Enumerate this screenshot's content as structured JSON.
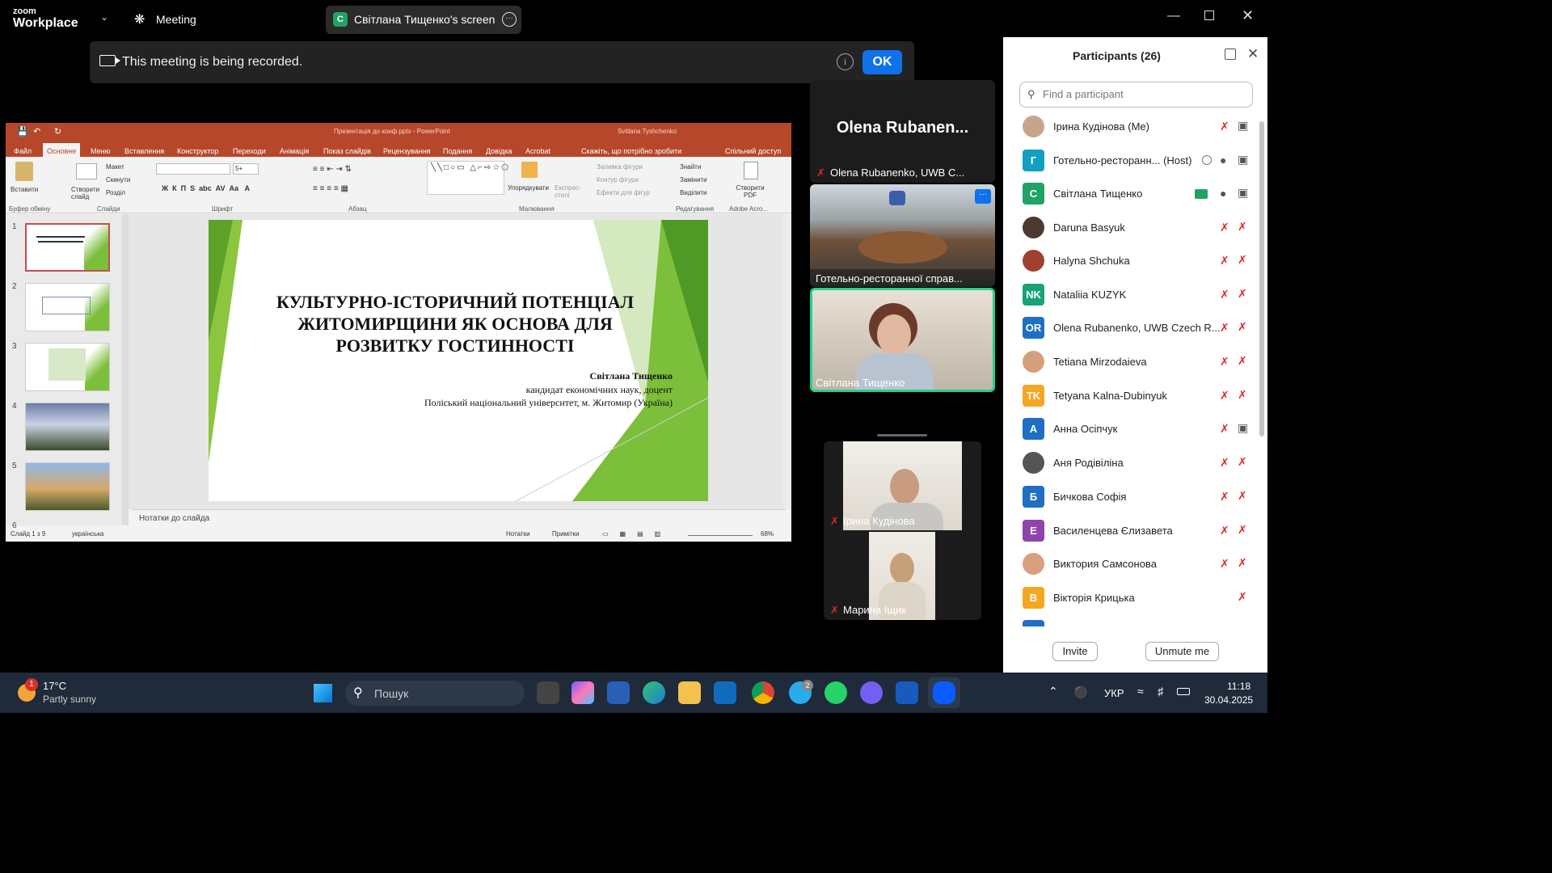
{
  "app": {
    "logo_top": "zoom",
    "logo_bottom": "Workplace",
    "meeting_label": "Meeting",
    "share_initial": "C",
    "share_label": "Світлана Тищенко's screen"
  },
  "recording": {
    "text": "This meeting is being recorded.",
    "ok_label": "OK"
  },
  "ppt": {
    "window_title": "Презентація до конф.pptx - PowerPoint",
    "user": "Svitlana Tyshchenko",
    "tabs": [
      "Файл",
      "Основне",
      "Меню",
      "Вставлення",
      "Конструктор",
      "Переходи",
      "Анімація",
      "Показ слайдів",
      "Рецензування",
      "Подання",
      "Довідка",
      "Acrobat"
    ],
    "tell_me": "Скажіть, що потрібно зробити",
    "share": "Спільний доступ",
    "groups": [
      "Буфер обміну",
      "Слайди",
      "Шрифт",
      "Абзац",
      "Малювання",
      "Редагування",
      "Adobe Acro..."
    ],
    "paste": "Вставити",
    "new_slide": "Створити слайд",
    "layout": "Макет",
    "reset": "Скинути",
    "section": "Розділ",
    "arrange": "Упорядкувати",
    "quick_styles": "Експрес-стилі",
    "shape_fill": "Заливка фігури",
    "shape_outline": "Контур фігури",
    "shape_effects": "Ефекти для фігур",
    "find": "Знайти",
    "replace": "Замінити",
    "select": "Виділити",
    "create_pdf": "Створити PDF",
    "font_size": "5+",
    "thumb_numbers": [
      "1",
      "2",
      "3",
      "4",
      "5",
      "6"
    ],
    "notes_placeholder": "Нотатки до слайда",
    "status_slide": "Слайд 1 з 9",
    "status_lang": "українська",
    "status_notes": "Нотатки",
    "status_comments": "Примітки",
    "zoom": "68%",
    "slide": {
      "title": "КУЛЬТУРНО-ІСТОРИЧНИЙ ПОТЕНЦІАЛ ЖИТОМИРЩИНИ ЯК ОСНОВА ДЛЯ РОЗВИТКУ ГОСТИННОСТІ",
      "author": "Світлана Тищенко",
      "degree": "кандидат економічних наук, доцент",
      "affiliation": "Поліський національний університет, м. Житомир (Україна)"
    }
  },
  "tiles": [
    {
      "display": "Olena  Rubanen...",
      "label": "Olena Rubanenko, UWB C..."
    },
    {
      "label": "Готельно-ресторанної справ..."
    },
    {
      "label": "Світлана Тищенко"
    },
    {
      "label": "Ірина  Кудінова"
    },
    {
      "label": "Марина Іщик"
    }
  ],
  "participants": {
    "title": "Participants (26)",
    "search_placeholder": "Find a participant",
    "list": [
      {
        "name": "Ірина  Кудінова (Me)",
        "initials": "",
        "color": "#c9a48c"
      },
      {
        "name": "Готельно-ресторанн... (Host)",
        "initials": "Г",
        "color": "#11a0c2"
      },
      {
        "name": "Світлана Тищенко",
        "initials": "С",
        "color": "#21a366"
      },
      {
        "name": "Daruna Basyuk",
        "initials": "",
        "color": "#4a3a30"
      },
      {
        "name": "Halyna Shchuka",
        "initials": "",
        "color": "#a04030"
      },
      {
        "name": "Nataliia KUZYK",
        "initials": "NK",
        "color": "#19a27a"
      },
      {
        "name": "Olena Rubanenko, UWB Czech R...",
        "initials": "OR",
        "color": "#1f6fc4"
      },
      {
        "name": "Tetiana Mirzodaieva",
        "initials": "",
        "color": "#d4a07c"
      },
      {
        "name": "Tetyana Kalna-Dubinyuk",
        "initials": "TK",
        "color": "#f5a623"
      },
      {
        "name": "Анна Осіпчук",
        "initials": "А",
        "color": "#1f6fc4"
      },
      {
        "name": "Аня Родівіліна",
        "initials": "",
        "color": "#555"
      },
      {
        "name": "Бичкова Софія",
        "initials": "Б",
        "color": "#1f6fc4"
      },
      {
        "name": "Василенцева Єлизавета",
        "initials": "Е",
        "color": "#8e44ad"
      },
      {
        "name": "Виктория Самсонова",
        "initials": "",
        "color": "#d9a080"
      },
      {
        "name": "Вікторія Крицька",
        "initials": "В",
        "color": "#f5a623"
      }
    ],
    "invite": "Invite",
    "unmute": "Unmute me"
  },
  "taskbar": {
    "weather_temp": "17°C",
    "weather_desc": "Partly sunny",
    "weather_badge": "1",
    "search": "Пошук",
    "telegram_badge": "2",
    "lang": "УКР",
    "time": "11:18",
    "date": "30.04.2025"
  }
}
